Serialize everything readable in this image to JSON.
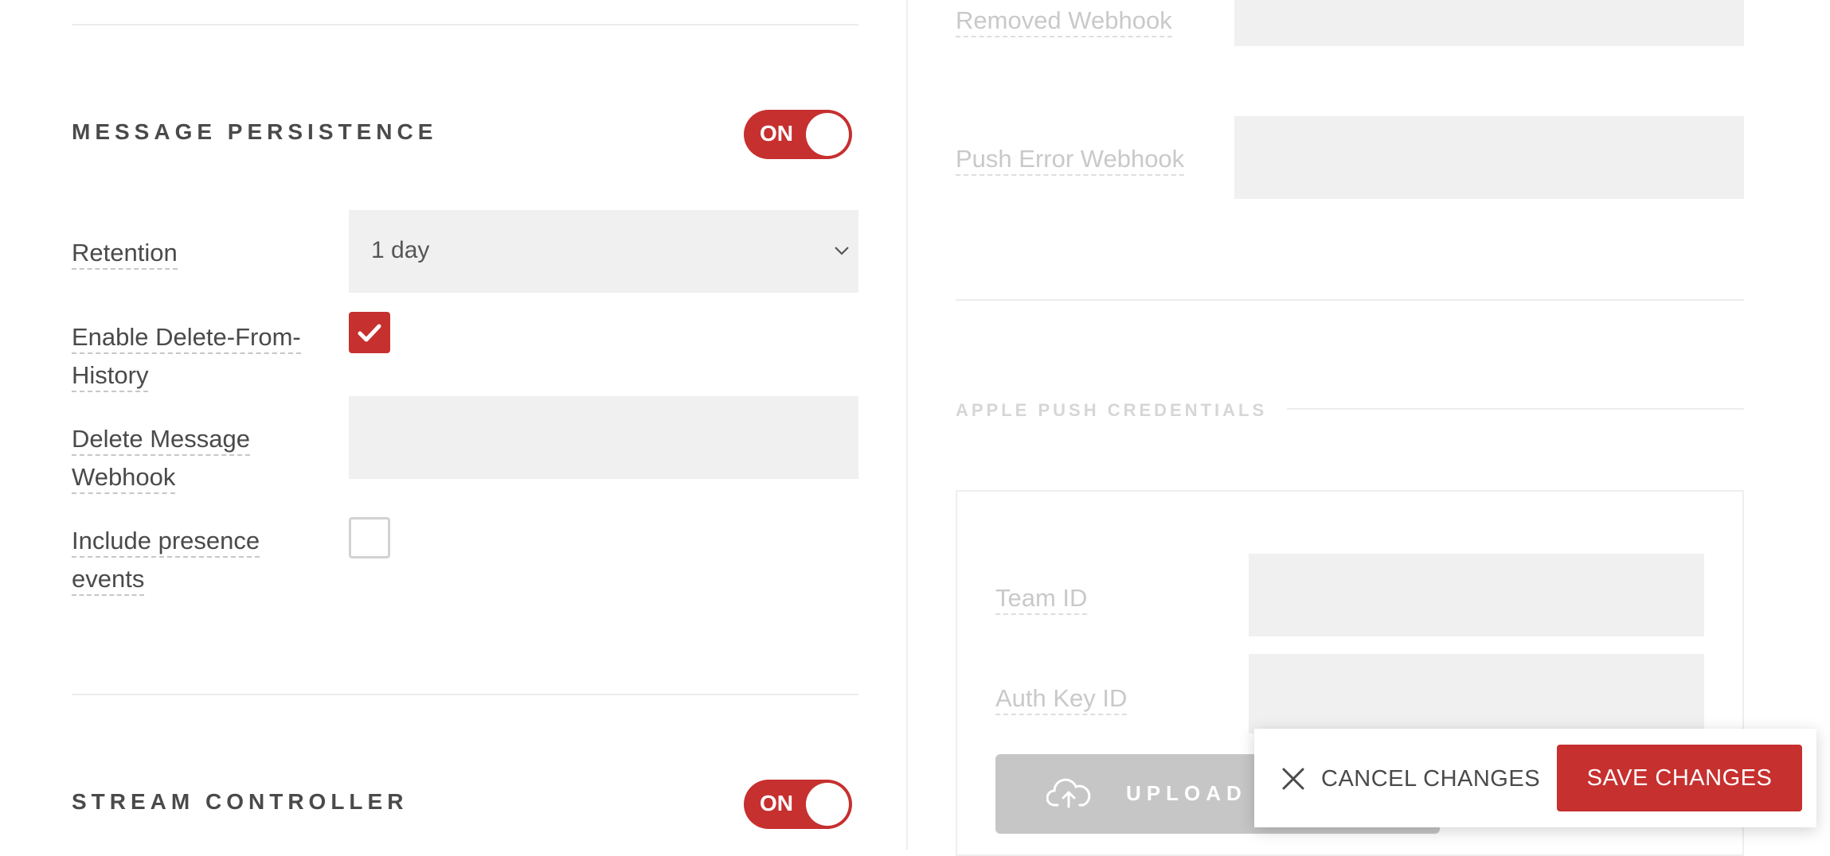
{
  "left": {
    "message_persistence": {
      "title": "MESSAGE PERSISTENCE",
      "toggle": "ON",
      "retention_label": "Retention",
      "retention_value": "1 day",
      "delete_from_history_label_1": "Enable Delete-From-",
      "delete_from_history_label_2": "History",
      "delete_from_history_checked": true,
      "delete_webhook_label_1": "Delete Message",
      "delete_webhook_label_2": "Webhook",
      "delete_webhook_value": "",
      "presence_label_1": "Include presence",
      "presence_label_2": "events",
      "presence_checked": false
    },
    "stream_controller": {
      "title": "STREAM CONTROLLER",
      "toggle": "ON"
    }
  },
  "right": {
    "removed_webhook_label": "Removed Webhook",
    "removed_webhook_value": "",
    "push_error_webhook_label": "Push Error Webhook",
    "push_error_webhook_value": "",
    "apple_push": {
      "title": "APPLE PUSH CREDENTIALS",
      "team_id_label": "Team ID",
      "team_id_value": "",
      "auth_key_id_label": "Auth Key ID",
      "auth_key_id_value": "",
      "upload_label": "UPLOAD T"
    }
  },
  "actions": {
    "cancel_label": "CANCEL CHANGES",
    "save_label": "SAVE CHANGES"
  },
  "colors": {
    "accent": "#c6302f",
    "field_bg": "#f0f0f0"
  },
  "icons": {
    "chevron": "chevron-down-icon",
    "check": "check-icon",
    "close": "close-icon",
    "upload": "cloud-upload-icon"
  }
}
